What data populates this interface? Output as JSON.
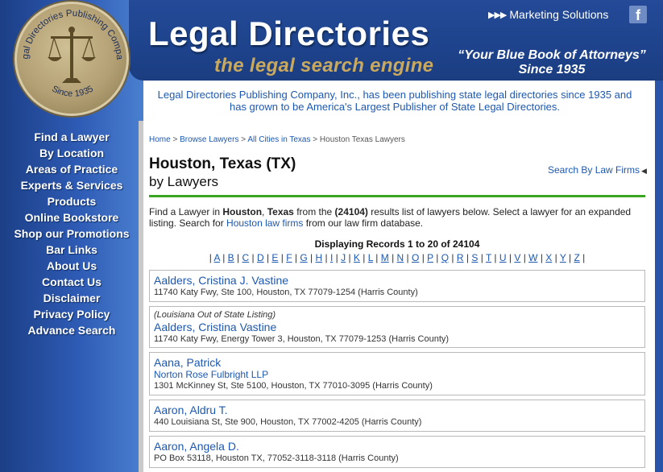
{
  "logo": {
    "ring_text": "Legal Directories Publishing Company",
    "since": "Since 1935"
  },
  "header": {
    "title": "Legal Directories",
    "tagline": "the legal search engine",
    "marketing_link": "Marketing Solutions",
    "facebook_icon_letter": "f",
    "blue_book_line1": "“Your Blue Book of Attorneys”",
    "blue_book_line2": "Since 1935"
  },
  "intro": "Legal Directories Publishing Company, Inc., has been publishing state legal directories since 1935 and has grown to be America's Largest Publisher of State Legal Directories.",
  "left_nav": [
    "Find a Lawyer",
    "By Location",
    "Areas of Practice",
    "Experts & Services",
    "Products",
    "Online Bookstore",
    "Shop our Promotions",
    "Bar Links",
    "About Us",
    "Contact Us",
    "Disclaimer",
    "Privacy Policy",
    "Advance Search"
  ],
  "breadcrumb": {
    "home": "Home",
    "browse": "Browse Lawyers",
    "cities": "All Cities in Texas",
    "current": "Houston Texas Lawyers",
    "sep": ">"
  },
  "page": {
    "heading": "Houston, Texas (TX)",
    "subheading": "by Lawyers",
    "search_firms": "Search By Law Firms",
    "desc_1": "Find a Lawyer in ",
    "desc_city": "Houston",
    "desc_2": ", ",
    "desc_state": "Texas",
    "desc_3": " from the ",
    "desc_count": "(24104)",
    "desc_4": " results list of lawyers below. Select a lawyer for an expanded listing. Search for ",
    "desc_link": "Houston law firms",
    "desc_5": " from our law firm database.",
    "displaying": "Displaying Records 1 to 20 of 24104"
  },
  "alphabet": [
    "A",
    "B",
    "C",
    "D",
    "E",
    "F",
    "G",
    "H",
    "I",
    "J",
    "K",
    "L",
    "M",
    "N",
    "O",
    "P",
    "Q",
    "R",
    "S",
    "T",
    "U",
    "V",
    "W",
    "X",
    "Y",
    "Z"
  ],
  "lawyers": [
    {
      "name": "Aalders, Cristina J. Vastine",
      "address": "11740 Katy Fwy, Ste 100, Houston, TX 77079-1254 (Harris County)"
    },
    {
      "note": "(Louisiana Out of State Listing)",
      "name": "Aalders, Cristina Vastine",
      "address": "11740 Katy Fwy, Energy Tower 3, Houston, TX 77079-1253 (Harris County)"
    },
    {
      "name": "Aana, Patrick",
      "firm": "Norton Rose Fulbright LLP",
      "address": "1301 McKinney St, Ste 5100, Houston, TX 77010-3095 (Harris County)"
    },
    {
      "name": "Aaron, Aldru T.",
      "address": "440 Louisiana St, Ste 900, Houston, TX 77002-4205 (Harris County)"
    },
    {
      "name": "Aaron, Angela D.",
      "address": "PO Box 53118, Houston TX, 77052-3118-3118 (Harris County)"
    }
  ]
}
